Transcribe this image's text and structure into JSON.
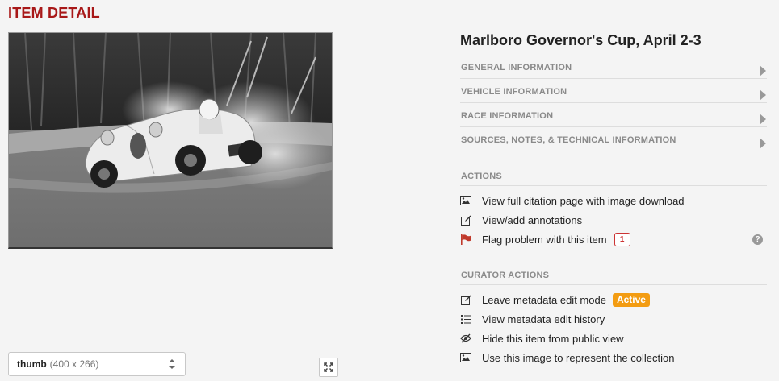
{
  "page_title": "ITEM DETAIL",
  "item": {
    "title": "Marlboro Governor's Cup, April 2-3"
  },
  "accordion": [
    {
      "label": "GENERAL INFORMATION"
    },
    {
      "label": "VEHICLE INFORMATION"
    },
    {
      "label": "RACE INFORMATION"
    },
    {
      "label": "SOURCES, NOTES, & TECHNICAL INFORMATION"
    }
  ],
  "actions": {
    "heading": "ACTIONS",
    "items": [
      {
        "label": "View full citation page with image download",
        "icon": "image-icon"
      },
      {
        "label": "View/add annotations",
        "icon": "pencil-icon"
      },
      {
        "label": "Flag problem with this item",
        "icon": "flag-icon",
        "badge": "1"
      }
    ]
  },
  "curator_actions": {
    "heading": "CURATOR ACTIONS",
    "items": [
      {
        "label": "Leave metadata edit mode",
        "icon": "pencil-icon",
        "status": "Active"
      },
      {
        "label": "View metadata edit history",
        "icon": "list-icon"
      },
      {
        "label": "Hide this item from public view",
        "icon": "eye-slash-icon"
      },
      {
        "label": "Use this image to represent the collection",
        "icon": "image-icon"
      }
    ]
  },
  "image_size_select": {
    "label": "thumb",
    "dimensions": "(400 x 266)"
  },
  "help": {
    "symbol": "?"
  },
  "colors": {
    "title_red": "#a81818",
    "flag_red": "#c0392b",
    "badge_orange": "#f39c12",
    "muted_heading": "#8a8a8a"
  }
}
